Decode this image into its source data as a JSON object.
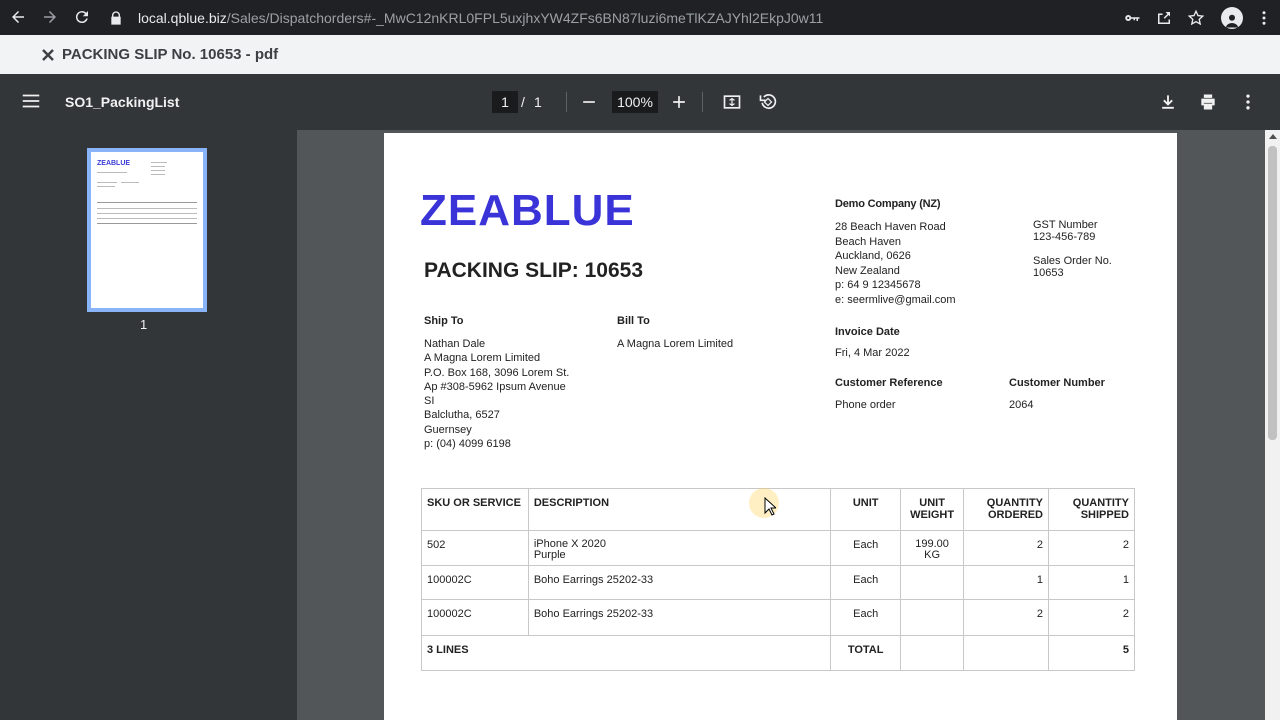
{
  "browser": {
    "url_host": "local.qblue.biz",
    "url_path": "/Sales/Dispatchorders#-_MwC12nKRL0FPL5uxjhxYW4ZFs6BN87luzi6meTlKZAJYhl2EkpJ0w11"
  },
  "tab": {
    "title": "PACKING SLIP No. 10653 - pdf"
  },
  "pdf_toolbar": {
    "file_name": "SO1_PackingList",
    "page_current": "1",
    "page_separator": "/",
    "page_total": "1",
    "zoom": "100%"
  },
  "sidebar": {
    "thumbnail_label": "1",
    "thumbnail_logo": "ZEABLUE"
  },
  "document": {
    "logo": "ZEABLUE",
    "title": "PACKING SLIP: 10653",
    "company": {
      "name": "Demo Company (NZ)",
      "address": [
        "28 Beach Haven Road",
        "Beach Haven",
        "Auckland, 0626",
        "New Zealand",
        "p: 64 9 12345678",
        "e: seermlive@gmail.com"
      ],
      "gst_label": "GST Number",
      "gst_value": "123-456-789",
      "so_label": "Sales Order No.",
      "so_value": "10653"
    },
    "ship_to": {
      "label": "Ship To",
      "lines": [
        "Nathan Dale",
        "A Magna Lorem Limited",
        "P.O. Box 168, 3096 Lorem St.",
        "Ap #308-5962 Ipsum Avenue",
        "SI",
        "Balclutha, 6527",
        "Guernsey",
        "p: (04) 4099 6198"
      ]
    },
    "bill_to": {
      "label": "Bill To",
      "lines": [
        "A Magna Lorem Limited"
      ]
    },
    "invoice_date": {
      "label": "Invoice Date",
      "value": "Fri, 4 Mar 2022"
    },
    "customer_reference": {
      "label": "Customer Reference",
      "value": "Phone order"
    },
    "customer_number": {
      "label": "Customer Number",
      "value": "2064"
    },
    "table": {
      "headers": {
        "sku": "SKU OR SERVICE",
        "description": "DESCRIPTION",
        "unit": "UNIT",
        "unit_weight_1": "UNIT",
        "unit_weight_2": "WEIGHT",
        "qty_ordered_1": "QUANTITY",
        "qty_ordered_2": "ORDERED",
        "qty_shipped_1": "QUANTITY",
        "qty_shipped_2": "SHIPPED"
      },
      "rows": [
        {
          "sku": "502",
          "description_1": "iPhone X 2020",
          "description_2": "Purple",
          "unit": "Each",
          "unit_weight_1": "199.00",
          "unit_weight_2": "KG",
          "qty_ordered": "2",
          "qty_shipped": "2"
        },
        {
          "sku": "100002C",
          "description_1": "Boho Earrings 25202-33",
          "description_2": "",
          "unit": "Each",
          "unit_weight_1": "",
          "unit_weight_2": "",
          "qty_ordered": "1",
          "qty_shipped": "1"
        },
        {
          "sku": "100002C",
          "description_1": "Boho Earrings 25202-33",
          "description_2": "",
          "unit": "Each",
          "unit_weight_1": "",
          "unit_weight_2": "",
          "qty_ordered": "2",
          "qty_shipped": "2"
        }
      ],
      "footer": {
        "lines": "3 LINES",
        "total_label": "TOTAL",
        "total_shipped": "5"
      }
    }
  },
  "colors": {
    "logo": "#3a34d8",
    "toolbar": "#323639",
    "viewer_bg": "#525659",
    "thumbnail_border": "#8ab4f8"
  },
  "icons": [
    "back-icon",
    "forward-icon",
    "reload-icon",
    "lock-icon",
    "key-icon",
    "share-icon",
    "star-icon",
    "profile-icon",
    "kebab-menu-icon",
    "close-icon",
    "hamburger-menu-icon",
    "zoom-out-icon",
    "zoom-in-icon",
    "fit-page-icon",
    "rotate-icon",
    "download-icon",
    "print-icon",
    "more-options-icon"
  ]
}
